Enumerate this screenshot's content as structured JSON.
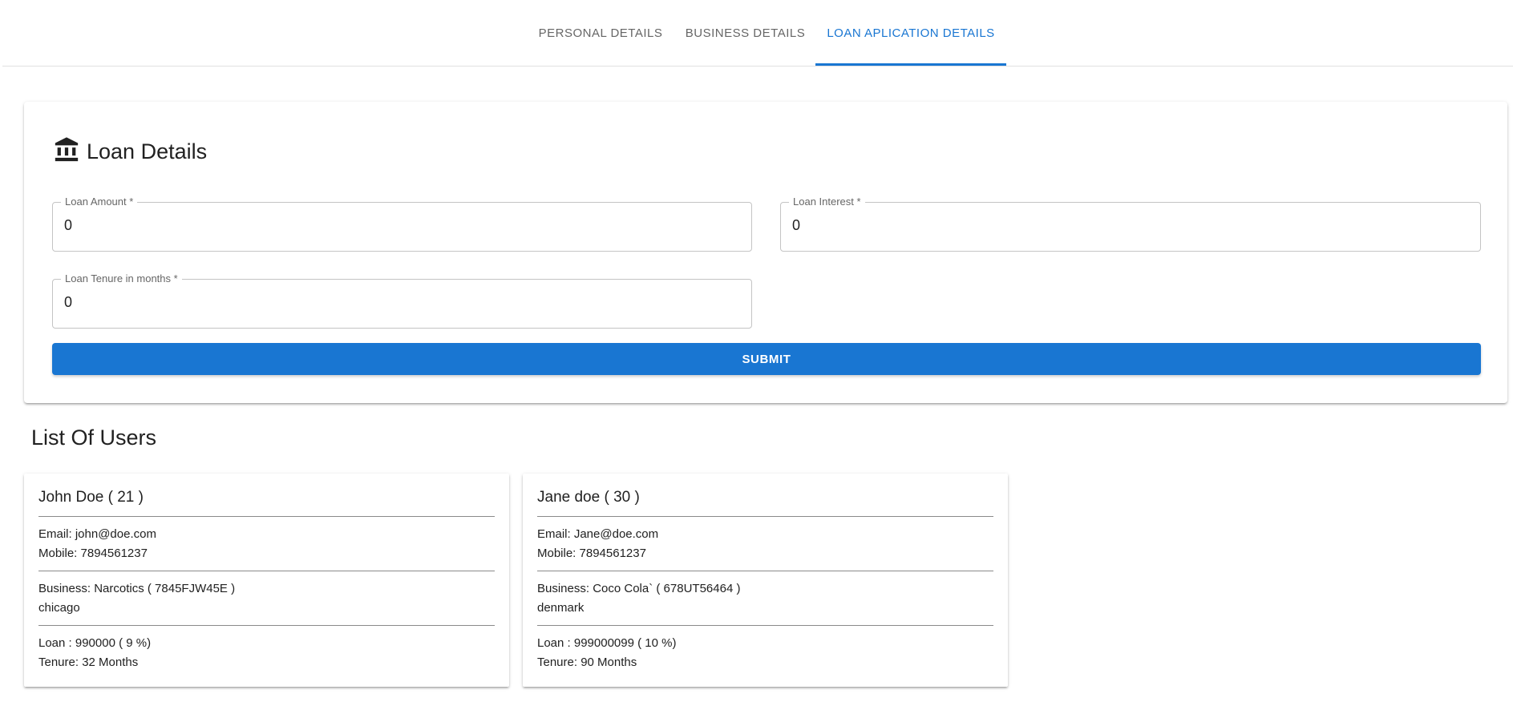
{
  "tabs": [
    {
      "label": "Personal Details",
      "active": false
    },
    {
      "label": "Business Details",
      "active": false
    },
    {
      "label": "Loan Aplication Details",
      "active": true
    }
  ],
  "accent_color": "#1976d2",
  "loan_card": {
    "icon": "bank-icon",
    "title": "Loan Details",
    "fields": {
      "amount": {
        "label": "Loan Amount *",
        "value": "0"
      },
      "interest": {
        "label": "Loan Interest *",
        "value": "0"
      },
      "tenure": {
        "label": "Loan Tenure in months *",
        "value": "0"
      }
    },
    "submit_label": "Submit"
  },
  "list_title": "List Of Users",
  "users": [
    {
      "name": "John Doe ( 21 )",
      "email": "Email: john@doe.com",
      "mobile": "Mobile: 7894561237",
      "business": "Business: Narcotics ( 7845FJW45E )",
      "location": "chicago",
      "loan": "Loan : 990000 ( 9 %)",
      "tenure": "Tenure: 32 Months"
    },
    {
      "name": "Jane doe ( 30 )",
      "email": "Email: Jane@doe.com",
      "mobile": "Mobile: 7894561237",
      "business": "Business: Coco Cola` ( 678UT56464 )",
      "location": "denmark",
      "loan": "Loan : 999000099 ( 10 %)",
      "tenure": "Tenure: 90 Months"
    }
  ]
}
